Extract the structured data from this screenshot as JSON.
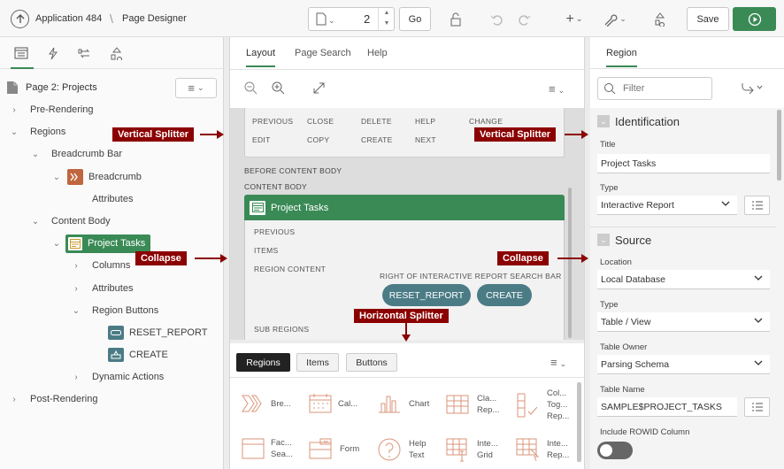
{
  "topbar": {
    "app_label": "Application 484",
    "page_label": "Page Designer",
    "page_number": "2",
    "go": "Go",
    "save": "Save"
  },
  "left": {
    "page_title": "Page 2: Projects",
    "tree": {
      "pre_rendering": "Pre-Rendering",
      "regions": "Regions",
      "breadcrumb_bar": "Breadcrumb Bar",
      "breadcrumb": "Breadcrumb",
      "attributes": "Attributes",
      "content_body": "Content Body",
      "project_tasks": "Project Tasks",
      "columns": "Columns",
      "attributes2": "Attributes",
      "region_buttons": "Region Buttons",
      "reset_report": "RESET_REPORT",
      "create": "CREATE",
      "dynamic_actions": "Dynamic Actions",
      "post_rendering": "Post-Rendering"
    }
  },
  "middle": {
    "tabs": [
      "Layout",
      "Page Search",
      "Help"
    ],
    "grid_labels": {
      "previous": "PREVIOUS",
      "close": "CLOSE",
      "delete": "DELETE",
      "help": "HELP",
      "change": "CHANGE",
      "edit": "EDIT",
      "copy": "COPY",
      "create": "CREATE",
      "next": "NEXT"
    },
    "before_content_body": "BEFORE CONTENT BODY",
    "content_body": "CONTENT BODY",
    "region_title": "Project Tasks",
    "region_previous": "PREVIOUS",
    "region_items": "ITEMS",
    "region_content": "REGION CONTENT",
    "right_of_search": "RIGHT OF INTERACTIVE REPORT SEARCH BAR",
    "btn_reset": "RESET_REPORT",
    "btn_create": "CREATE",
    "sub_regions": "SUB REGIONS",
    "gallery_tabs": [
      "Regions",
      "Items",
      "Buttons"
    ],
    "gallery": [
      {
        "label": "Bre...",
        "icon": "breadcrumb-icon"
      },
      {
        "label": "Cal...",
        "icon": "calendar-icon"
      },
      {
        "label": "Chart",
        "icon": "chart-icon"
      },
      {
        "label": "Cla...\nRep...",
        "icon": "classic-report-icon"
      },
      {
        "label": "Col...\nTog...\nRep...",
        "icon": "column-toggle-icon"
      },
      {
        "label": "Fac...\nSea...",
        "icon": "faceted-search-icon"
      },
      {
        "label": "Form",
        "icon": "form-icon"
      },
      {
        "label": "Help\nText",
        "icon": "help-text-icon"
      },
      {
        "label": "Inte...\nGrid",
        "icon": "interactive-grid-icon"
      },
      {
        "label": "Inte...\nRep...",
        "icon": "interactive-report-icon"
      }
    ]
  },
  "right": {
    "tab": "Region",
    "filter_placeholder": "Filter",
    "identification": "Identification",
    "title_label": "Title",
    "title_value": "Project Tasks",
    "type_label": "Type",
    "type_value": "Interactive Report",
    "source": "Source",
    "location_label": "Location",
    "location_value": "Local Database",
    "type2_label": "Type",
    "type2_value": "Table / View",
    "owner_label": "Table Owner",
    "owner_value": "Parsing Schema",
    "table_label": "Table Name",
    "table_value": "SAMPLE$PROJECT_TASKS",
    "rowid_label": "Include ROWID Column"
  },
  "callouts": {
    "vertical_splitter_left": "Vertical Splitter",
    "vertical_splitter_right": "Vertical Splitter",
    "collapse_left": "Collapse",
    "collapse_right": "Collapse",
    "horizontal_splitter": "Horizontal Splitter"
  },
  "colors": {
    "accent": "#3a8a56",
    "button_teal": "#4b7c86",
    "callout": "#8b0000",
    "breadcrumb_orange": "#c0663e"
  }
}
